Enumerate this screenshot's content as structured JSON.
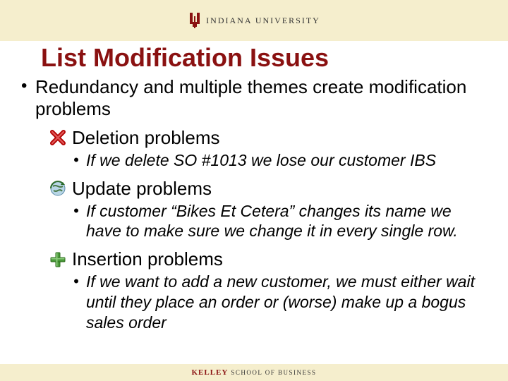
{
  "header": {
    "institution": "INDIANA UNIVERSITY"
  },
  "title": "List Modification Issues",
  "bullets": {
    "main": "Redundancy and multiple themes create modification problems",
    "sections": [
      {
        "icon": "delete-x-icon",
        "label": "Deletion problems",
        "sub": "If we delete SO #1013 we lose our customer IBS"
      },
      {
        "icon": "globe-refresh-icon",
        "label": "Update problems",
        "sub": "If customer “Bikes Et Cetera” changes its name we have to make sure we change it in every single row."
      },
      {
        "icon": "plus-add-icon",
        "label": "Insertion problems",
        "sub": "If we want to add a new customer, we must either wait until they place an order or (worse) make up a bogus sales order"
      }
    ]
  },
  "footer": {
    "school_strong": "KELLEY",
    "school_rest": "SCHOOL OF BUSINESS"
  }
}
